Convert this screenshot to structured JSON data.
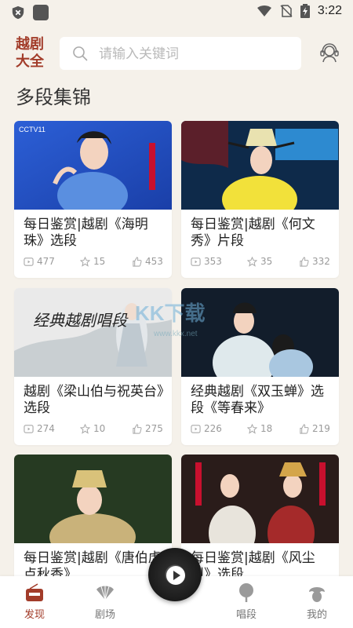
{
  "status_bar": {
    "time": "3:22"
  },
  "header": {
    "logo_line1": "越剧",
    "logo_line2": "大全",
    "search_placeholder": "请输入关键词"
  },
  "section": {
    "title": "多段集锦"
  },
  "cards": [
    {
      "title": "每日鉴赏|越剧《海明珠》选段",
      "plays": "477",
      "stars": "15",
      "likes": "453",
      "thumb_badge": "CCTV11"
    },
    {
      "title": "每日鉴赏|越剧《何文秀》片段",
      "plays": "353",
      "stars": "35",
      "likes": "332",
      "thumb_badge": ""
    },
    {
      "title": "越剧《梁山伯与祝英台》选段",
      "plays": "274",
      "stars": "10",
      "likes": "275",
      "thumb_text": "经典越剧唱段"
    },
    {
      "title": "经典越剧《双玉蝉》选段《等春来》",
      "plays": "226",
      "stars": "18",
      "likes": "219"
    },
    {
      "title": "每日鉴赏|越剧《唐伯虎点秋香》",
      "plays": "",
      "stars": "",
      "likes": ""
    },
    {
      "title": "每日鉴赏|越剧《风尘烈》选段",
      "plays": "",
      "stars": "",
      "likes": ""
    }
  ],
  "watermark": {
    "text": "KK下载",
    "url": "www.kkx.net"
  },
  "bottom_nav": [
    {
      "label": "发现",
      "active": true
    },
    {
      "label": "剧场",
      "active": false
    },
    {
      "label": "唱段",
      "active": false
    },
    {
      "label": "我的",
      "active": false
    }
  ],
  "colors": {
    "accent": "#a23c2a",
    "background": "#f5f1ea"
  }
}
